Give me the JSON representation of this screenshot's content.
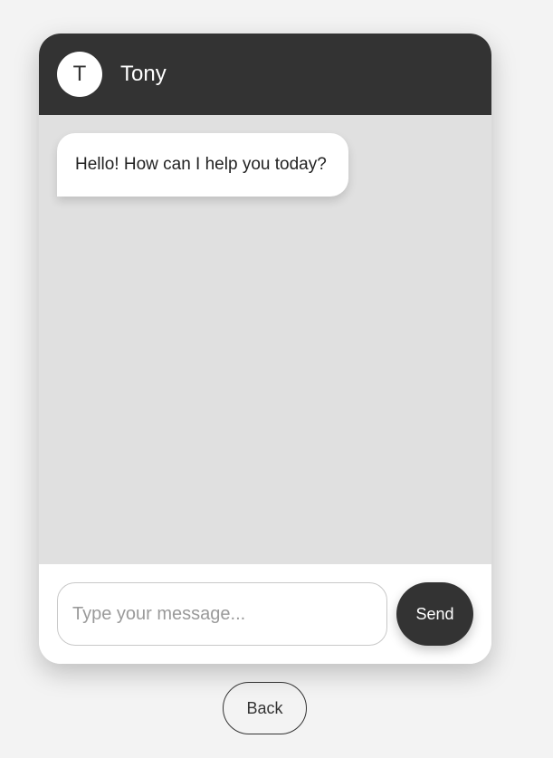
{
  "contact": {
    "initial": "T",
    "name": "Tony"
  },
  "messages": [
    {
      "text": "Hello! How can I help you today?"
    }
  ],
  "composer": {
    "placeholder": "Type your message...",
    "value": "",
    "send_label": "Send"
  },
  "navigation": {
    "back_label": "Back"
  },
  "colors": {
    "page_background": "#f3f3f3",
    "header_background": "#333333",
    "messages_background": "#e0e0e0",
    "bubble_background": "#ffffff",
    "send_button": "#333333"
  }
}
